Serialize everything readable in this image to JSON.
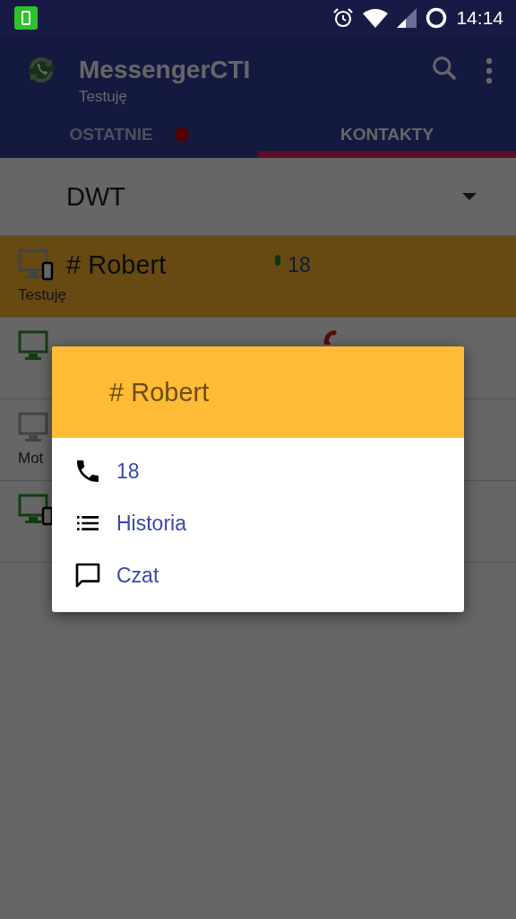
{
  "status_bar": {
    "time": "14:14"
  },
  "app_bar": {
    "title": "MessengerCTI",
    "subtitle": "Testuję"
  },
  "tabs": [
    {
      "label": "OSTATNIE",
      "selected": false,
      "badge": true
    },
    {
      "label": "KONTAKTY",
      "selected": true,
      "badge": false
    }
  ],
  "group_select": {
    "value": "DWT"
  },
  "contacts": [
    {
      "name": "# Robert",
      "number": "18",
      "status": "Testuję",
      "selected": true,
      "online": false,
      "mobile": true,
      "presence": true,
      "in_call": false
    },
    {
      "selected": false,
      "online": true,
      "mobile": false,
      "presence": false,
      "in_call": true
    },
    {
      "status": "Mot",
      "selected": false,
      "online": false,
      "mobile": false,
      "presence": false,
      "in_call": false
    },
    {
      "selected": false,
      "online": true,
      "mobile": true,
      "presence": false,
      "in_call": false
    }
  ],
  "dialog": {
    "title": "# Robert",
    "actions": [
      {
        "kind": "call",
        "label": "18"
      },
      {
        "kind": "history",
        "label": "Historia"
      },
      {
        "kind": "chat",
        "label": "Czat"
      }
    ]
  }
}
